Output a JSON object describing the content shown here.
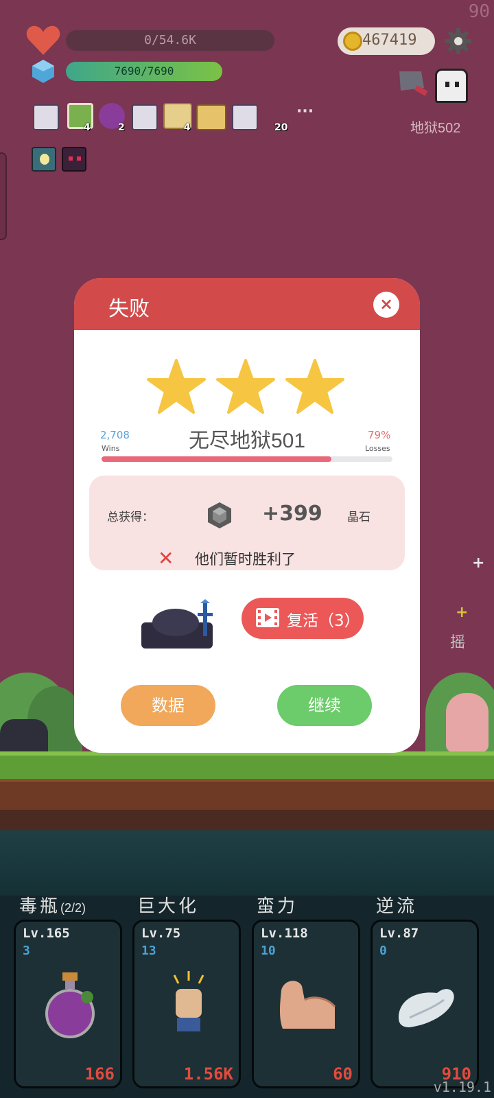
{
  "hud": {
    "fps": "90",
    "hp_text": "0/54.6K",
    "mp_text": "7690/7690",
    "coins": "467419",
    "level_name": "地狱502",
    "more_label": "···",
    "inventory": [
      {
        "icon": "scroll-ribbon-icon",
        "count": ""
      },
      {
        "icon": "green-card-icon",
        "count": "4"
      },
      {
        "icon": "purple-potion-icon",
        "count": "2"
      },
      {
        "icon": "scroll-ribbon-icon",
        "count": ""
      },
      {
        "icon": "parchment-scroll-icon",
        "count": "4"
      },
      {
        "icon": "treasure-map-icon",
        "count": ""
      },
      {
        "icon": "scroll-ribbon-icon",
        "count": "20"
      }
    ],
    "buffs": [
      "light-bulb-buff-icon",
      "demon-buff-icon"
    ]
  },
  "dialog": {
    "title": "失败",
    "close_label": "×",
    "stars": 3,
    "stage_name": "无尽地狱501",
    "wins_value": "2,708",
    "wins_label": "Wins",
    "losses_value": "79%",
    "losses_label": "Losses",
    "ratio_fill": 0.79,
    "reward_label": "总获得：",
    "reward_amount": "+399",
    "reward_unit": "晶石",
    "fail_mark": "✕",
    "fail_message": "他们暂时胜利了",
    "revive_label": "复活（3）",
    "data_button": "数据",
    "continue_button": "继续"
  },
  "skills": [
    {
      "name": "毒瓶",
      "suffix": "(2/2)",
      "level": "Lv.165",
      "sub": "3",
      "cost": "166",
      "icon": "poison-bottle-icon"
    },
    {
      "name": "巨大化",
      "suffix": "",
      "level": "Lv.75",
      "sub": "13",
      "cost": "1.56K",
      "icon": "fist-icon"
    },
    {
      "name": "蛮力",
      "suffix": "",
      "level": "Lv.118",
      "sub": "10",
      "cost": "60",
      "icon": "muscle-arm-icon"
    },
    {
      "name": "逆流",
      "suffix": "",
      "level": "Lv.87",
      "sub": "0",
      "cost": "910",
      "icon": "wing-icon"
    }
  ],
  "version": "v1.19.1",
  "colors": {
    "background": "#7b3651",
    "dialog_header": "#d34a4a",
    "data_button": "#f1a85a",
    "continue_button": "#6ccb6a",
    "revive_button": "#ec5858",
    "cost_text": "#e14b3e"
  }
}
